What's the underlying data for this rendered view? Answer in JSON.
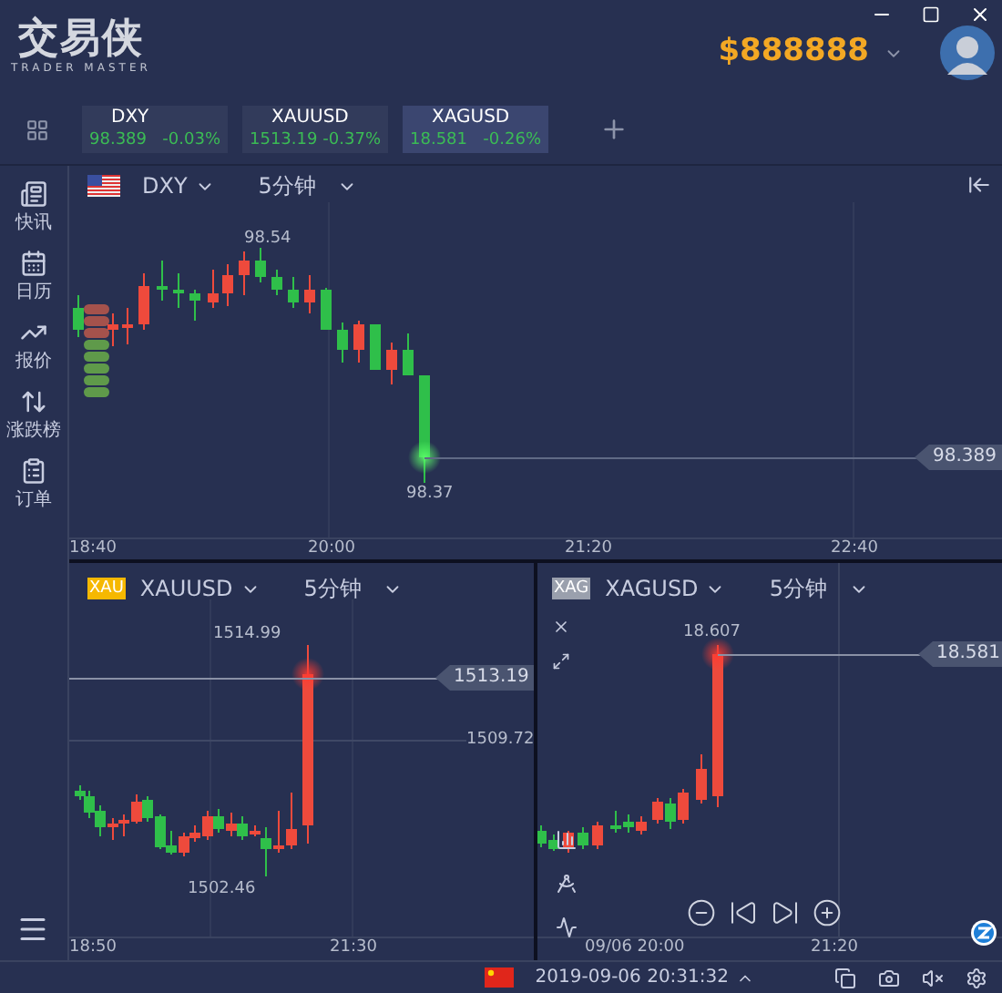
{
  "app": {
    "logo": "交易侠",
    "logo_sub": "TRADER MASTER"
  },
  "balance": "$888888",
  "quote_tabs": [
    {
      "symbol": "DXY",
      "price": "98.389",
      "change": "-0.03%",
      "selected": false
    },
    {
      "symbol": "XAUUSD",
      "price": "1513.19",
      "change": "-0.37%",
      "selected": false
    },
    {
      "symbol": "XAGUSD",
      "price": "18.581",
      "change": "-0.26%",
      "selected": true
    }
  ],
  "sidebar": {
    "items": [
      {
        "label": "快讯",
        "kind": "news"
      },
      {
        "label": "日历",
        "kind": "calendar"
      },
      {
        "label": "报价",
        "kind": "quotes"
      },
      {
        "label": "涨跌榜",
        "kind": "ranking"
      },
      {
        "label": "订单",
        "kind": "orders"
      }
    ]
  },
  "charts": [
    {
      "kind": "flag",
      "symbol": "DXY",
      "interval": "5分钟",
      "high_label": "98.54",
      "low_label": "98.37",
      "price_tag": "98.389",
      "xticks": [
        "18:40",
        "20:00",
        "21:20",
        "22:40"
      ]
    },
    {
      "kind": "badge",
      "symbol": "XAUUSD",
      "badge": "XAU",
      "interval": "5分钟",
      "high_label": "1514.99",
      "low_label": "1502.46",
      "price_tag": "1513.19",
      "level_label": "1509.72",
      "xticks": [
        "18:50",
        "21:30"
      ]
    },
    {
      "kind": "badge",
      "symbol": "XAGUSD",
      "badge": "XAG",
      "interval": "5分钟",
      "high_label": "18.607",
      "price_tag": "18.581",
      "xticks": [
        "09/06 20:00",
        "21:20"
      ]
    }
  ],
  "status_bar": {
    "datetime": "2019-09-06 20:31:32"
  }
}
